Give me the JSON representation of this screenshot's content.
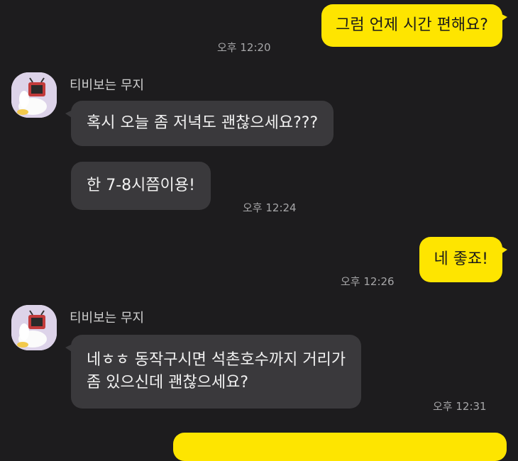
{
  "chat": {
    "contact_name": "티비보는 무지",
    "messages": [
      {
        "from": "me",
        "text": "그럼 언제 시간 편해요?",
        "time": "오후 12:20"
      },
      {
        "from": "them",
        "text": "혹시 오늘 좀 저녁도 괜찮으세요???"
      },
      {
        "from": "them",
        "text": "한 7-8시쯤이용!",
        "time": "오후 12:24"
      },
      {
        "from": "me",
        "text": "네 좋죠!",
        "time": "오후 12:26"
      },
      {
        "from": "them",
        "line1": "네ㅎㅎ 동작구시면 석촌호수까지 거리가",
        "line2": "좀 있으신데 괜찮으세요?",
        "time": "오후 12:31"
      }
    ]
  },
  "colors": {
    "background": "#1d1c1e",
    "my_bubble": "#fee500",
    "their_bubble": "#3a393c"
  },
  "icons": {
    "avatar": "muzi-watching-tv-icon"
  }
}
